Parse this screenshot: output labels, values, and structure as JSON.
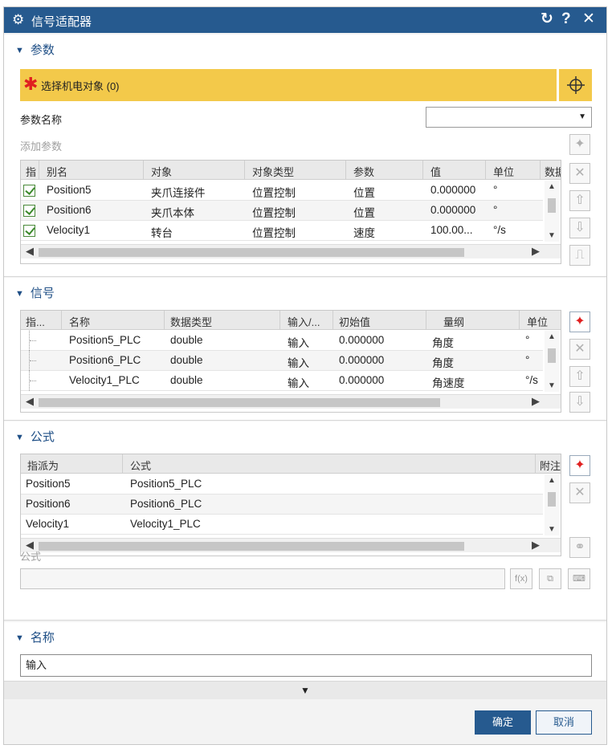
{
  "window": {
    "title": "信号适配器",
    "gear_icon": "gear-icon",
    "reset_icon": "↻",
    "help_label": "?",
    "close_label": "✕"
  },
  "parameters": {
    "header": "参数",
    "select_object": "选择机电对象 (0)",
    "param_name_label": "参数名称",
    "param_name_value": "",
    "add_param_label": "添加参数",
    "columns": [
      "指",
      "别名",
      "对象",
      "对象类型",
      "参数",
      "值",
      "单位",
      "数据"
    ],
    "rows": [
      {
        "checked": true,
        "alias": "Position5",
        "object": "夹爪连接件",
        "object_type": "位置控制",
        "param": "位置",
        "value": "0.000000",
        "unit": "°"
      },
      {
        "checked": true,
        "alias": "Position6",
        "object": "夹爪本体",
        "object_type": "位置控制",
        "param": "位置",
        "value": "0.000000",
        "unit": "°"
      },
      {
        "checked": true,
        "alias": "Velocity1",
        "object": "转台",
        "object_type": "位置控制",
        "param": "速度",
        "value": "100.00...",
        "unit": "°/s"
      }
    ]
  },
  "signals": {
    "header": "信号",
    "columns": [
      "指...",
      "名称",
      "数据类型",
      "输入/...",
      "初始值",
      "量纲",
      "单位"
    ],
    "rows": [
      {
        "name": "Position5_PLC",
        "data_type": "double",
        "io": "输入",
        "initial": "0.000000",
        "dimension": "角度",
        "unit": "°"
      },
      {
        "name": "Position6_PLC",
        "data_type": "double",
        "io": "输入",
        "initial": "0.000000",
        "dimension": "角度",
        "unit": "°"
      },
      {
        "name": "Velocity1_PLC",
        "data_type": "double",
        "io": "输入",
        "initial": "0.000000",
        "dimension": "角速度",
        "unit": "°/s"
      }
    ]
  },
  "formulas": {
    "header": "公式",
    "columns": [
      "指派为",
      "公式",
      "附注"
    ],
    "rows": [
      {
        "assign": "Position5",
        "formula": "Position5_PLC"
      },
      {
        "assign": "Position6",
        "formula": "Position6_PLC"
      },
      {
        "assign": "Velocity1",
        "formula": "Velocity1_PLC"
      }
    ],
    "formula_label": "公式",
    "formula_value": "",
    "fx_label": "f(x)"
  },
  "name_section": {
    "header": "名称",
    "value": "输入"
  },
  "footer": {
    "ok_label": "确定",
    "cancel_label": "取消"
  }
}
